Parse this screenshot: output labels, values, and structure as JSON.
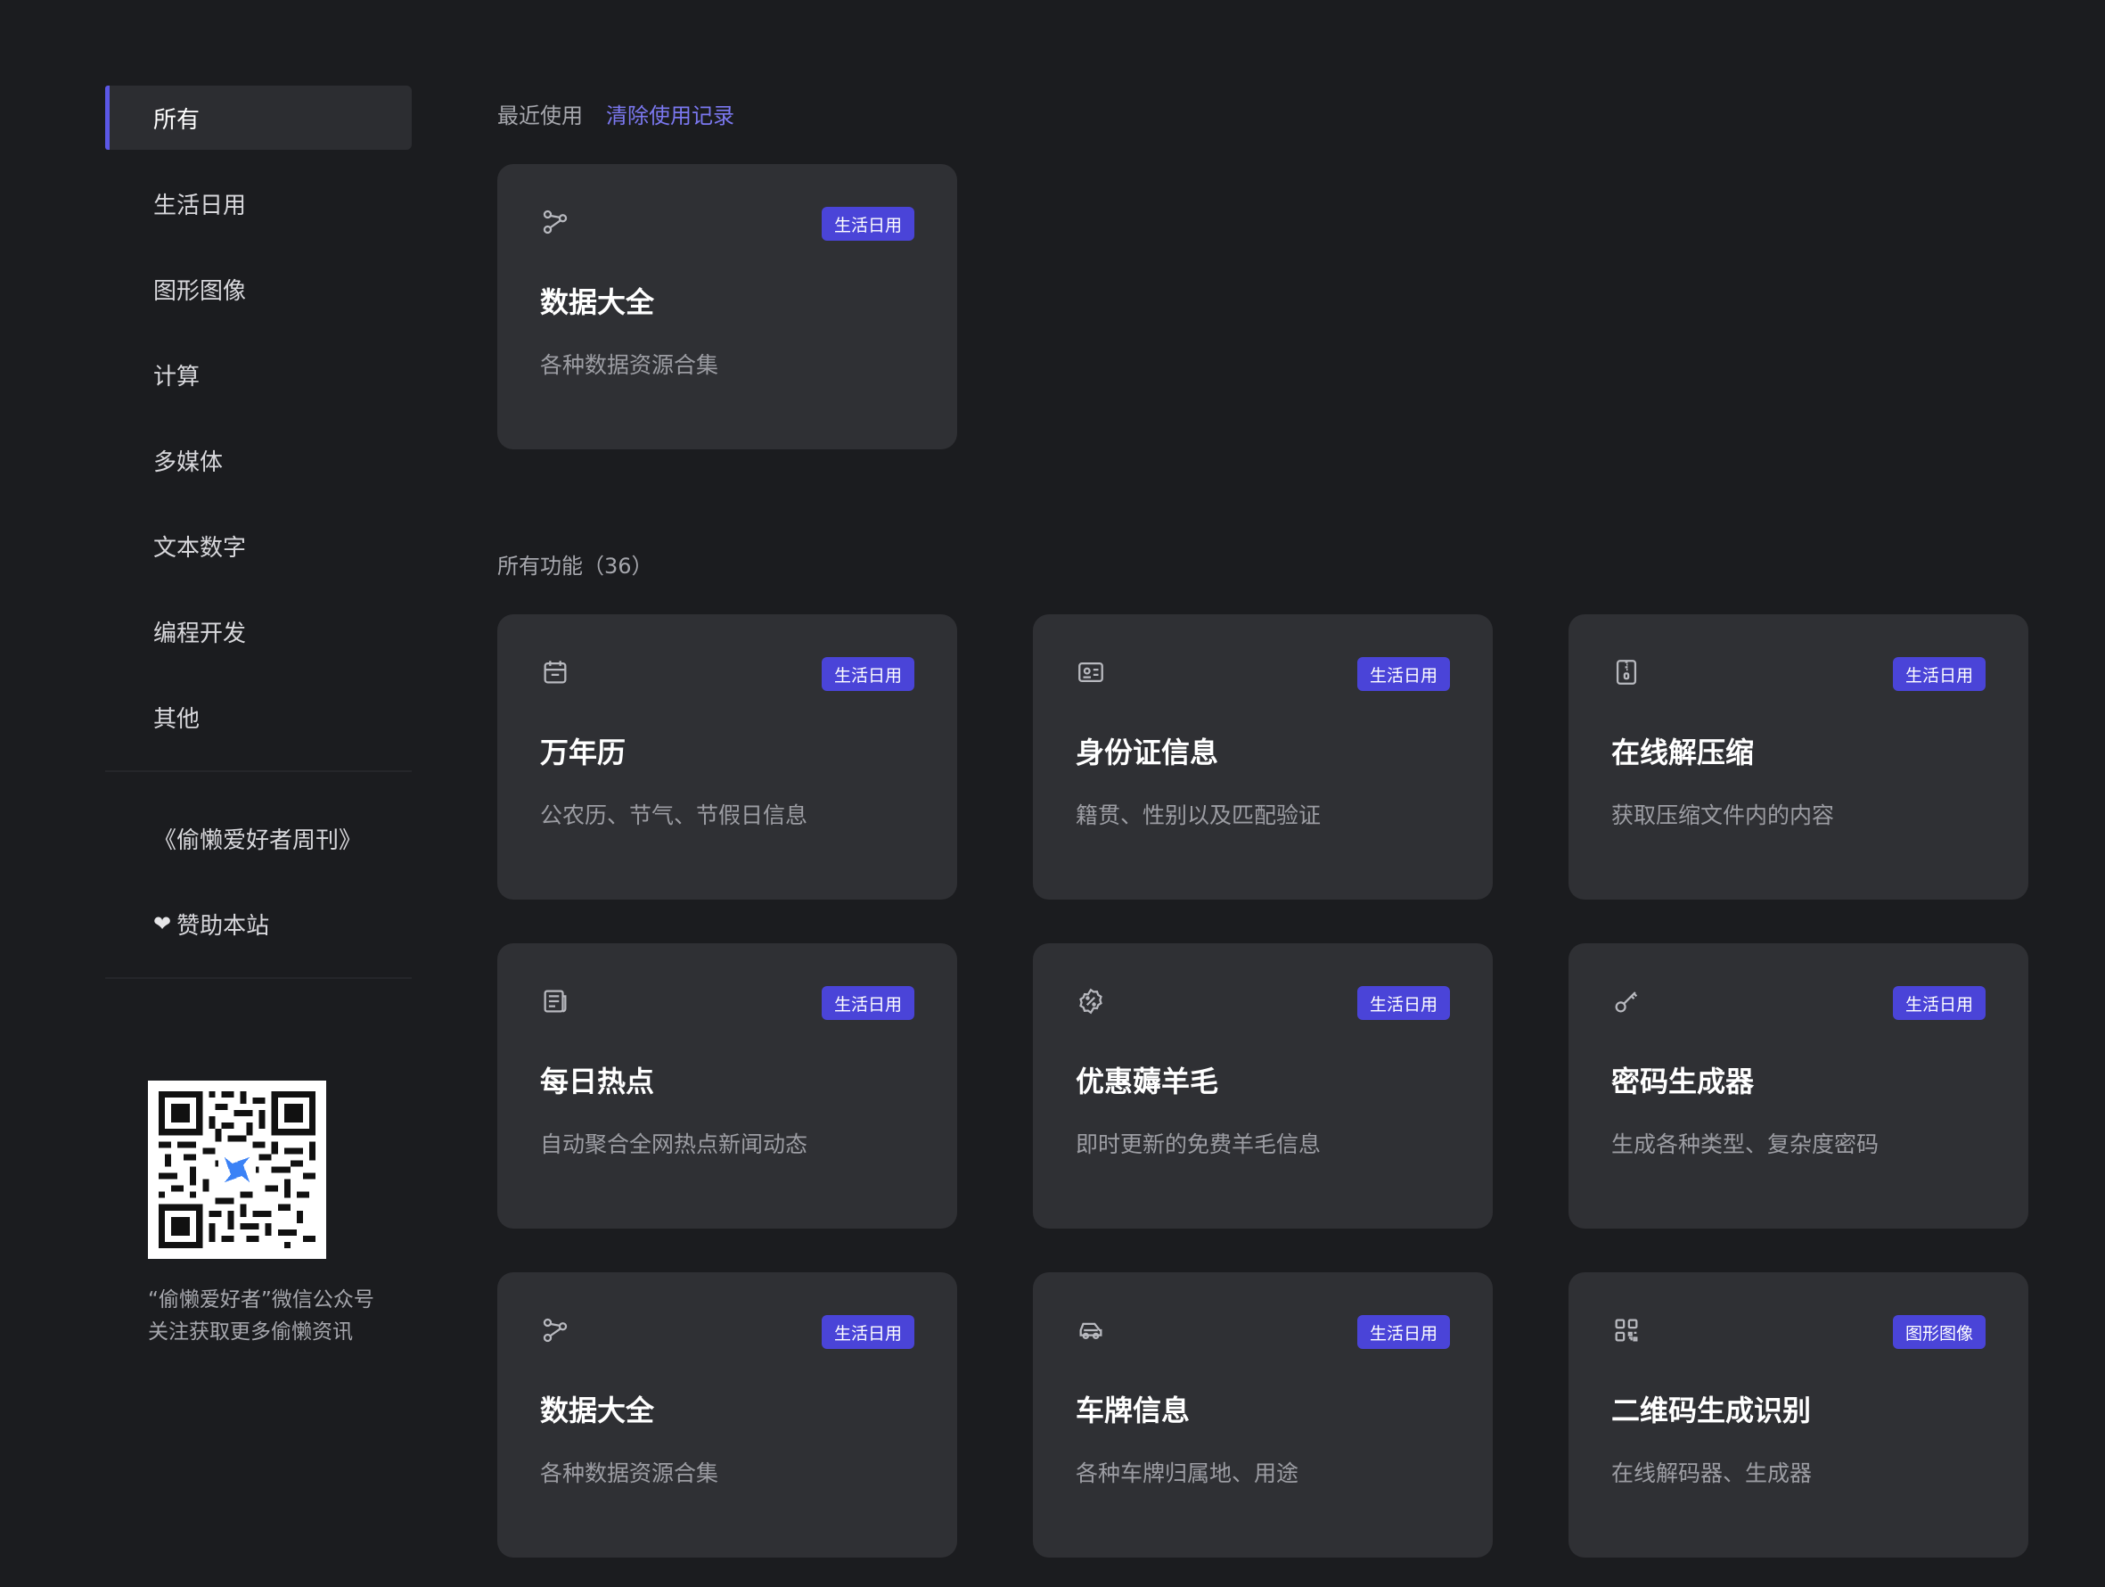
{
  "sidebar": {
    "items": [
      {
        "label": "所有"
      },
      {
        "label": "生活日用"
      },
      {
        "label": "图形图像"
      },
      {
        "label": "计算"
      },
      {
        "label": "多媒体"
      },
      {
        "label": "文本数字"
      },
      {
        "label": "编程开发"
      },
      {
        "label": "其他"
      }
    ],
    "weekly_label": "《偷懒爱好者周刊》",
    "sponsor_label": "赞助本站",
    "sponsor_icon": "heart-icon",
    "qr_caption_line1": "“偷懒爱好者”微信公众号",
    "qr_caption_line2": "关注获取更多偷懒资讯"
  },
  "recent": {
    "title": "最近使用",
    "clear_label": "清除使用记录",
    "cards": [
      {
        "title": "数据大全",
        "desc": "各种数据资源合集",
        "tag": "生活日用",
        "icon": "share-nodes-icon"
      }
    ]
  },
  "all": {
    "title": "所有功能（36）",
    "cards": [
      {
        "title": "万年历",
        "desc": "公农历、节气、节假日信息",
        "tag": "生活日用",
        "icon": "calendar-icon"
      },
      {
        "title": "身份证信息",
        "desc": "籍贯、性别以及匹配验证",
        "tag": "生活日用",
        "icon": "id-card-icon"
      },
      {
        "title": "在线解压缩",
        "desc": "获取压缩文件内的内容",
        "tag": "生活日用",
        "icon": "zip-file-icon"
      },
      {
        "title": "每日热点",
        "desc": "自动聚合全网热点新闻动态",
        "tag": "生活日用",
        "icon": "newspaper-icon"
      },
      {
        "title": "优惠薅羊毛",
        "desc": "即时更新的免费羊毛信息",
        "tag": "生活日用",
        "icon": "discount-icon"
      },
      {
        "title": "密码生成器",
        "desc": "生成各种类型、复杂度密码",
        "tag": "生活日用",
        "icon": "key-icon"
      },
      {
        "title": "数据大全",
        "desc": "各种数据资源合集",
        "tag": "生活日用",
        "icon": "share-nodes-icon"
      },
      {
        "title": "车牌信息",
        "desc": "各种车牌归属地、用途",
        "tag": "生活日用",
        "icon": "car-icon"
      },
      {
        "title": "二维码生成识别",
        "desc": "在线解码器、生成器",
        "tag": "图形图像",
        "icon": "qrcode-icon"
      }
    ]
  },
  "colors": {
    "accent": "#5b57e6",
    "tag": "#4a44d8",
    "link": "#7b78f0",
    "card": "#2f3034",
    "background": "#1b1c1f"
  }
}
